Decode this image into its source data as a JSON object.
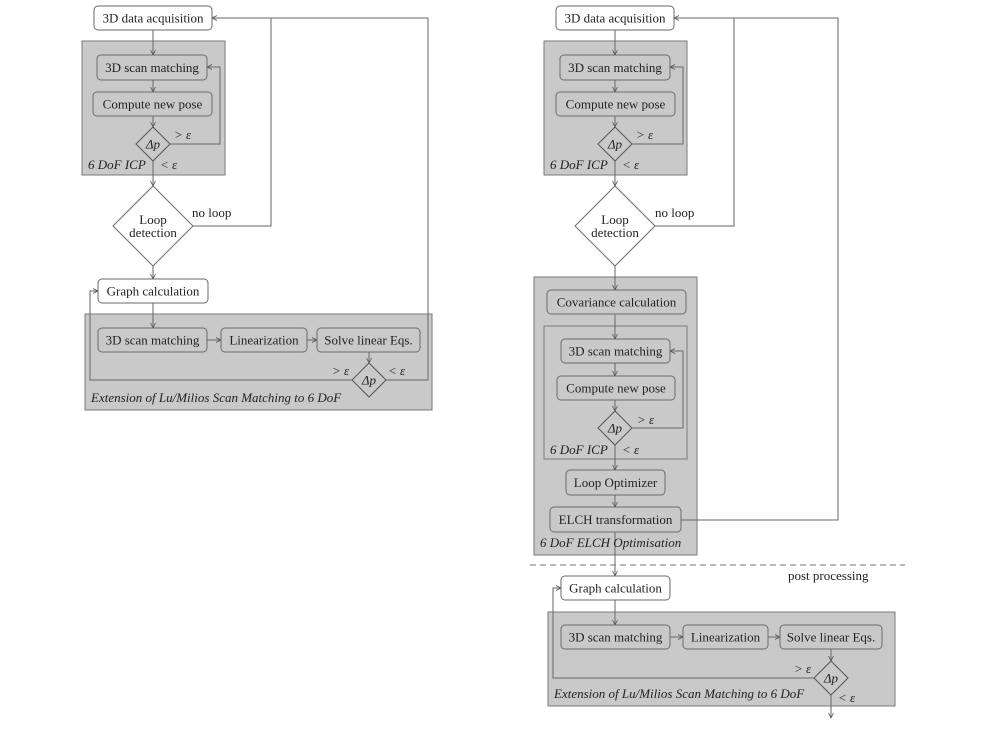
{
  "left": {
    "acquisition": "3D data acquisition",
    "icp": {
      "scan_matching": "3D scan matching",
      "compute_pose": "Compute new pose",
      "delta": "Δp",
      "gt": "> ε",
      "lt": "< ε",
      "label": "6 DoF ICP"
    },
    "loop_detection": [
      "Loop",
      "detection"
    ],
    "no_loop": "no loop",
    "graph": "Graph calculation",
    "lum": {
      "scan_matching": "3D scan matching",
      "linearization": "Linearization",
      "solve": "Solve linear Eqs.",
      "delta": "Δp",
      "gt": "> ε",
      "lt": "< ε",
      "label": "Extension of Lu/Milios Scan Matching to 6 DoF"
    }
  },
  "right": {
    "acquisition": "3D data acquisition",
    "icp": {
      "scan_matching": "3D scan matching",
      "compute_pose": "Compute new pose",
      "delta": "Δp",
      "gt": "> ε",
      "lt": "< ε",
      "label": "6 DoF ICP"
    },
    "loop_detection": [
      "Loop",
      "detection"
    ],
    "no_loop": "no loop",
    "elch": {
      "covariance": "Covariance calculation",
      "icp": {
        "scan_matching": "3D scan matching",
        "compute_pose": "Compute new pose",
        "delta": "Δp",
        "gt": "> ε",
        "lt": "< ε",
        "label": "6 DoF ICP"
      },
      "loop_optimizer": "Loop Optimizer",
      "transformation": "ELCH transformation",
      "label": "6 DoF ELCH Optimisation"
    },
    "post_processing": "post processing",
    "graph": "Graph calculation",
    "lum": {
      "scan_matching": "3D scan matching",
      "linearization": "Linearization",
      "solve": "Solve linear Eqs.",
      "delta": "Δp",
      "gt": "> ε",
      "lt": "< ε",
      "label": "Extension of Lu/Milios Scan Matching to 6 DoF"
    }
  }
}
